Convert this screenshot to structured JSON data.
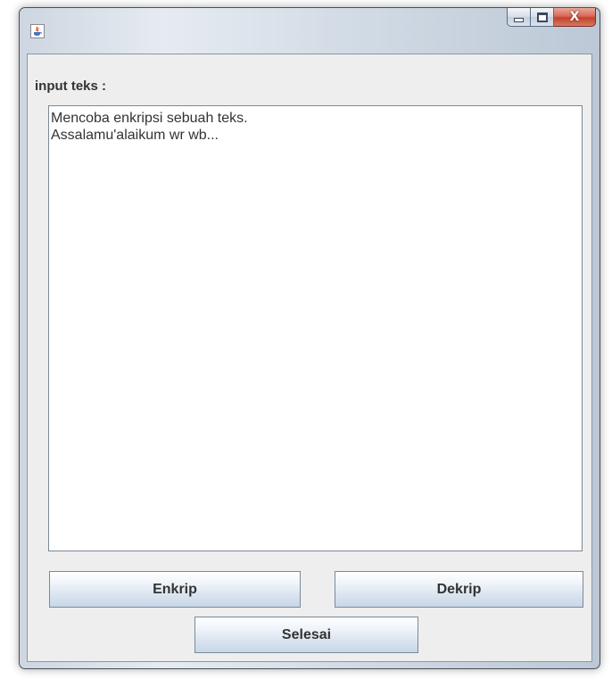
{
  "window": {
    "title": "",
    "icon": "java-icon",
    "controls": {
      "minimize_icon": "minimize-icon",
      "maximize_icon": "maximize-icon",
      "close_glyph": "X"
    }
  },
  "form": {
    "label": "input teks :",
    "text_lines": [
      "Mencoba enkripsi sebuah teks.",
      "Assalamu'alaikum wr wb..."
    ]
  },
  "buttons": {
    "enkrip": "Enkrip",
    "dekrip": "Dekrip",
    "selesai": "Selesai"
  }
}
